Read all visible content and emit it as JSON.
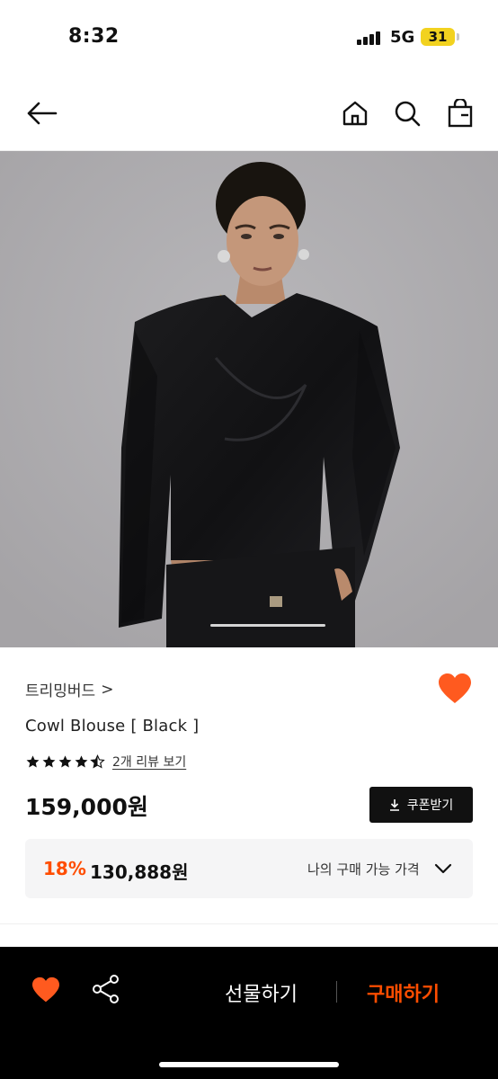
{
  "status_bar": {
    "time": "8:32",
    "network": "5G",
    "battery": "31"
  },
  "nav": {
    "back_icon": "arrow-left-icon",
    "home_icon": "home-icon",
    "search_icon": "search-icon",
    "cart_icon": "shopping-bag-icon"
  },
  "product": {
    "brand": "트리밍버드",
    "brand_chevron": ">",
    "name": "Cowl Blouse [ Black ]",
    "rating": 4.5,
    "reviews_link": "2개 리뷰 보기",
    "price": "159,000원",
    "coupon_label": "쿠폰받기",
    "wishlisted": true
  },
  "my_price": {
    "discount_rate": "18%",
    "discount_price": "130,888원",
    "label": "나의 구매 가능 가격"
  },
  "bottom_bar": {
    "gift_label": "선물하기",
    "buy_label": "구매하기"
  },
  "colors": {
    "accent": "#ff4d00",
    "heart": "#ff5a1f",
    "dark": "#111111"
  }
}
